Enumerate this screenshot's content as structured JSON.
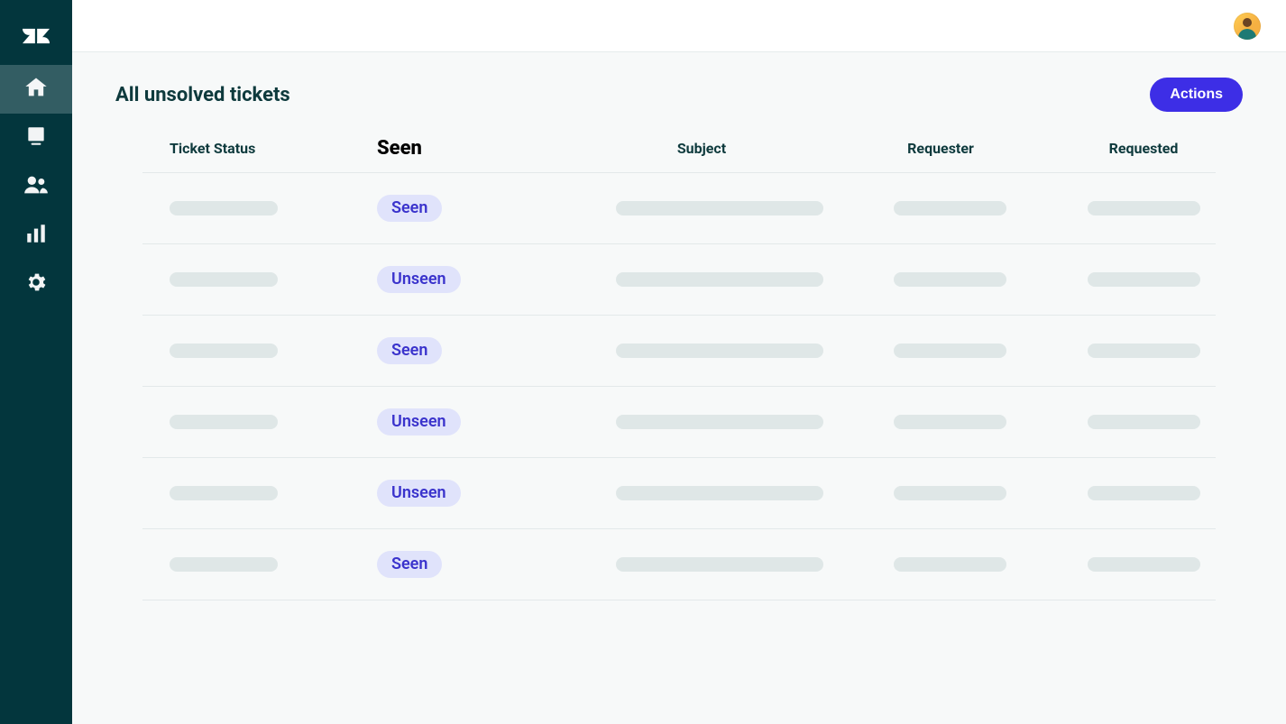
{
  "page": {
    "title": "All unsolved tickets"
  },
  "header": {
    "actions_label": "Actions"
  },
  "sidebar": {
    "items": [
      {
        "id": "home",
        "name": "home-icon",
        "active": true
      },
      {
        "id": "views",
        "name": "views-icon",
        "active": false
      },
      {
        "id": "customers",
        "name": "customers-icon",
        "active": false
      },
      {
        "id": "reporting",
        "name": "reporting-icon",
        "active": false
      },
      {
        "id": "admin",
        "name": "settings-icon",
        "active": false
      }
    ]
  },
  "columns": {
    "status": "Ticket Status",
    "seen": "Seen",
    "subject": "Subject",
    "requester": "Requester",
    "requested": "Requested"
  },
  "rows": [
    {
      "seen": "Seen"
    },
    {
      "seen": "Unseen"
    },
    {
      "seen": "Seen"
    },
    {
      "seen": "Unseen"
    },
    {
      "seen": "Unseen"
    },
    {
      "seen": "Seen"
    }
  ]
}
